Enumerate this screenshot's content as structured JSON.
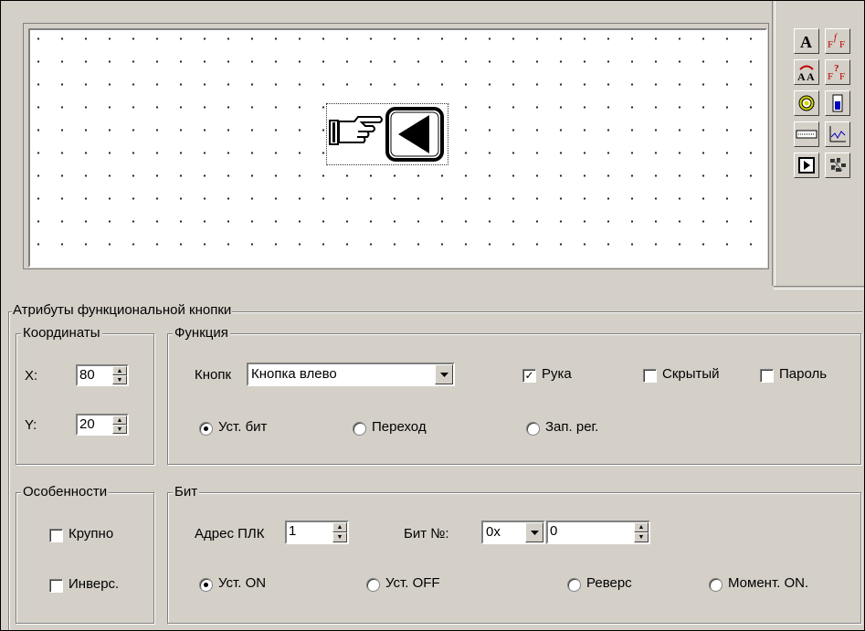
{
  "panel": {
    "title": "Атрибуты функциональной кнопки",
    "coords": {
      "legend": "Координаты",
      "x_label": "X:",
      "x_value": "80",
      "y_label": "Y:",
      "y_value": "20"
    },
    "function": {
      "legend": "Функция",
      "button_label": "Кнопк",
      "button_value": "Кнопка влево",
      "hand_label": "Рука",
      "hand_checked": true,
      "hidden_label": "Скрытый",
      "hidden_checked": false,
      "password_label": "Пароль",
      "password_checked": false,
      "radios": [
        "Уст. бит",
        "Переход",
        "Зап. рег."
      ],
      "selected_radio": 0
    },
    "features": {
      "legend": "Особенности",
      "large_label": "Крупно",
      "invert_label": "Инверс."
    },
    "bit": {
      "legend": "Бит",
      "plc_label": "Адрес ПЛК",
      "plc_value": "1",
      "bitno_label": "Бит №:",
      "prefix_value": "0x",
      "bit_value": "0",
      "radios": [
        "Уст. ON",
        "Уст. OFF",
        "Реверс",
        "Момент. ON."
      ],
      "selected_radio": 0
    }
  },
  "toolbar": {
    "tools": [
      "text-tool-icon",
      "font-tool-icon",
      "text-swap-icon",
      "font-variable-icon",
      "lamp-icon",
      "bit-switch-icon",
      "numeric-display-icon",
      "trend-chart-icon",
      "function-button-icon",
      "multi-state-icon"
    ]
  },
  "colors": {
    "face": "#d4d0c8",
    "shadow": "#808080",
    "highlight": "#ffffff"
  }
}
